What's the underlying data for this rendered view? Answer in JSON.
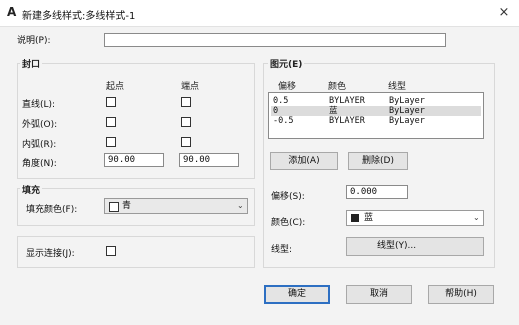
{
  "window": {
    "title": "新建多线样式:多线样式-1",
    "close_glyph": "×",
    "app_icon_glyph": "A"
  },
  "description": {
    "label": "说明(P):",
    "value": ""
  },
  "caps": {
    "title": "封口",
    "col_start": "起点",
    "col_end": "端点",
    "rows": [
      {
        "label": "直线(L):",
        "start_checked": false,
        "end_checked": false
      },
      {
        "label": "外弧(O):",
        "start_checked": false,
        "end_checked": false
      },
      {
        "label": "内弧(R):",
        "start_checked": false,
        "end_checked": false
      }
    ],
    "angle": {
      "label": "角度(N):",
      "start": "90.00",
      "end": "90.00"
    }
  },
  "fill": {
    "title": "填充",
    "color_label": "填充颜色(F):",
    "color_value": "青",
    "swatch_color": "#ffffff"
  },
  "joints": {
    "label": "显示连接(J):",
    "checked": false
  },
  "elements": {
    "title": "图元(E)",
    "columns": [
      "偏移",
      "颜色",
      "线型"
    ],
    "rows": [
      {
        "offset": "0.5",
        "color": "BYLAYER",
        "linetype": "ByLayer",
        "selected": false
      },
      {
        "offset": "0",
        "color": "蓝",
        "linetype": "ByLayer",
        "selected": true
      },
      {
        "offset": "-0.5",
        "color": "BYLAYER",
        "linetype": "ByLayer",
        "selected": false
      }
    ],
    "add_button": "添加(A)",
    "delete_button": "删除(D)",
    "offset_label": "偏移(S):",
    "offset_value": "0.000",
    "color_label": "颜色(C):",
    "color_value": "蓝",
    "color_swatch": "#222222",
    "linetype_label": "线型:",
    "linetype_button": "线型(Y)..."
  },
  "footer": {
    "ok": "确定",
    "cancel": "取消",
    "help": "帮助(H)"
  },
  "colors": {
    "dialog_bg": "#f3f3f3",
    "default_button_border": "#2d6fc2"
  }
}
